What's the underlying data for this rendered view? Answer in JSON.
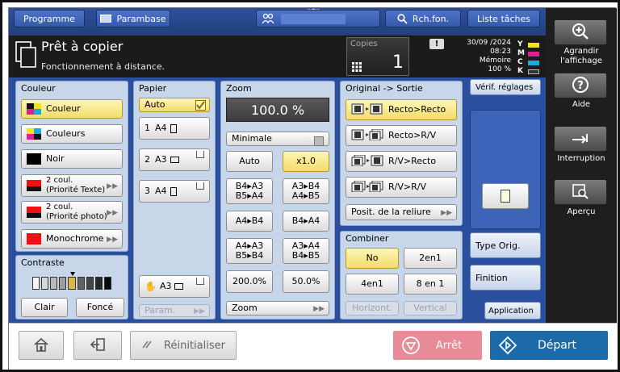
{
  "topbar": {
    "programme": "Programme",
    "parambase": "Parambase",
    "search": "Rch.fon.",
    "job_list": "Liste tâches",
    "notch": "«‹•›»"
  },
  "status": {
    "title": "Prêt à copier",
    "subtitle": "Fonctionnement à distance.",
    "copies_label": "Copies",
    "copies_value": "1",
    "warning": "!",
    "date": "30/09 /2024",
    "time": "08:23",
    "memory_label": "Mémoire",
    "memory_value": "100 %",
    "ink": [
      "Y",
      "M",
      "C",
      "K"
    ],
    "ink_colors": [
      "#f2e21a",
      "#e0208f",
      "#18a9e6",
      "#333333"
    ]
  },
  "sidebar": {
    "zoom_display_label": "Agrandir l'affichage",
    "help_label": "Aide",
    "interrupt_label": "Interruption",
    "preview_label": "Aperçu"
  },
  "couleur": {
    "title": "Couleur",
    "items": [
      {
        "label": "Couleur",
        "selected": true
      },
      {
        "label": "Couleurs"
      },
      {
        "label": "Noir"
      },
      {
        "label": "2 coul.\n(Priorité Texte)"
      },
      {
        "label": "2 coul.\n(Priorité photo)"
      },
      {
        "label": "Monochrome"
      }
    ]
  },
  "contraste": {
    "title": "Contraste",
    "level": 4,
    "steps": 9,
    "clear": "Clair",
    "dark": "Foncé"
  },
  "papier": {
    "title": "Papier",
    "auto": "Auto",
    "trays": [
      {
        "num": "1",
        "size": "A4"
      },
      {
        "num": "2",
        "size": "A3"
      },
      {
        "num": "3",
        "size": "A4"
      }
    ],
    "bypass": "A3",
    "param": "Param."
  },
  "zoom": {
    "title": "Zoom",
    "value": "100.0 %",
    "minimal": "Minimale",
    "auto": "Auto",
    "x10": "x1.0",
    "b4a3_b5a4": "B4▸A3\nB5▸A4",
    "a3b4_a4b5": "A3▸B4\nA4▸B5",
    "a4b4": "A4▸B4",
    "b4a4": "B4▸A4",
    "a4a3_b5b4": "A4▸A3\nB5▸B4",
    "a3a4_b4b5": "A3▸A4\nB4▸B5",
    "p200": "200.0%",
    "p50": "50.0%",
    "zoom": "Zoom"
  },
  "original": {
    "title": "Original -> Sortie",
    "items": [
      "Recto>Recto",
      "Recto>R/V",
      "R/V>Recto",
      "R/V>R/V"
    ],
    "binding": "Posit. de la reliure",
    "check": "Vérif. réglages"
  },
  "combiner": {
    "title": "Combiner",
    "no": "No",
    "two": "2en1",
    "four": "4en1",
    "eight": "8 en 1",
    "horizontal": "Horizont.",
    "vertical": "Vertical"
  },
  "rightcol": {
    "type_orig": "Type Orig.",
    "finition": "Finition",
    "application": "Application"
  },
  "bottom": {
    "reset": "Réinitialiser",
    "stop": "Arrêt",
    "start": "Départ"
  }
}
